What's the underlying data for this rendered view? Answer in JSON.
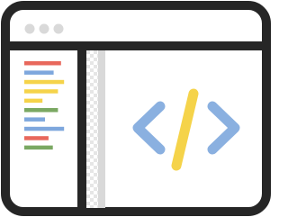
{
  "colors": {
    "frame": "#262626",
    "window_bg": "#ffffff",
    "titlebar_dot": "#d9d9d9",
    "scrollbar": "#d9d9d9",
    "checker": "#e6e6e6",
    "code_red": "#e8685c",
    "code_blue": "#7ea7dd",
    "code_yellow": "#f5d34a",
    "code_green": "#7aa862",
    "bracket_blue": "#8ab0e0",
    "slash_yellow": "#f5d34a"
  },
  "icons": {
    "window": "browser-window-icon",
    "code": "code-brackets-icon"
  },
  "sidebar": {
    "lines": [
      {
        "color": "code_red",
        "length": 0.85
      },
      {
        "color": "code_blue",
        "length": 0.68
      },
      {
        "color": "code_yellow",
        "length": 0.92
      },
      {
        "color": "code_yellow",
        "length": 0.78
      },
      {
        "color": "code_yellow",
        "length": 0.42
      },
      {
        "color": "code_green",
        "length": 0.78
      },
      {
        "color": "code_blue",
        "length": 0.48
      },
      {
        "color": "code_blue",
        "length": 0.92
      },
      {
        "color": "code_red",
        "length": 0.56
      },
      {
        "color": "code_green",
        "length": 0.66
      }
    ]
  },
  "titlebar": {
    "dot_count": 3
  }
}
